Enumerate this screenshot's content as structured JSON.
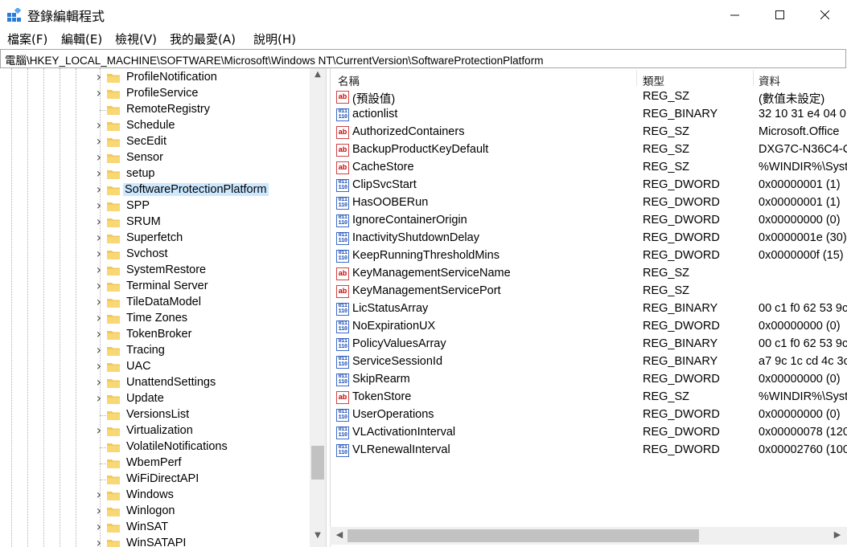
{
  "window": {
    "title": "登錄編輯程式",
    "minimize_glyph": "—",
    "maximize_glyph": "☐",
    "close_glyph": "✕"
  },
  "menu": [
    "檔案(F)",
    "編輯(E)",
    "檢視(V)",
    "我的最愛(A)",
    "說明(H)"
  ],
  "address": "電腦\\HKEY_LOCAL_MACHINE\\SOFTWARE\\Microsoft\\Windows NT\\CurrentVersion\\SoftwareProtectionPlatform",
  "tree": {
    "selected": "SoftwareProtectionPlatform",
    "items": [
      {
        "label": "ProfileNotification",
        "expandable": true
      },
      {
        "label": "ProfileService",
        "expandable": true
      },
      {
        "label": "RemoteRegistry",
        "expandable": false
      },
      {
        "label": "Schedule",
        "expandable": true
      },
      {
        "label": "SecEdit",
        "expandable": true
      },
      {
        "label": "Sensor",
        "expandable": true
      },
      {
        "label": "setup",
        "expandable": true
      },
      {
        "label": "SoftwareProtectionPlatform",
        "expandable": true
      },
      {
        "label": "SPP",
        "expandable": true
      },
      {
        "label": "SRUM",
        "expandable": true
      },
      {
        "label": "Superfetch",
        "expandable": true
      },
      {
        "label": "Svchost",
        "expandable": true
      },
      {
        "label": "SystemRestore",
        "expandable": true
      },
      {
        "label": "Terminal Server",
        "expandable": true
      },
      {
        "label": "TileDataModel",
        "expandable": true
      },
      {
        "label": "Time Zones",
        "expandable": true
      },
      {
        "label": "TokenBroker",
        "expandable": true
      },
      {
        "label": "Tracing",
        "expandable": true
      },
      {
        "label": "UAC",
        "expandable": true
      },
      {
        "label": "UnattendSettings",
        "expandable": true
      },
      {
        "label": "Update",
        "expandable": true
      },
      {
        "label": "VersionsList",
        "expandable": false
      },
      {
        "label": "Virtualization",
        "expandable": true
      },
      {
        "label": "VolatileNotifications",
        "expandable": false
      },
      {
        "label": "WbemPerf",
        "expandable": false
      },
      {
        "label": "WiFiDirectAPI",
        "expandable": false
      },
      {
        "label": "Windows",
        "expandable": true
      },
      {
        "label": "Winlogon",
        "expandable": true
      },
      {
        "label": "WinSAT",
        "expandable": true
      },
      {
        "label": "WinSATAPI",
        "expandable": true
      }
    ]
  },
  "columns": {
    "name": "名稱",
    "type": "類型",
    "data": "資料"
  },
  "values": [
    {
      "kind": "str",
      "name": "(預設值)",
      "type": "REG_SZ",
      "data": "(數值未設定)"
    },
    {
      "kind": "bin",
      "name": "actionlist",
      "type": "REG_BINARY",
      "data": "32 10 31 e4 04 0"
    },
    {
      "kind": "str",
      "name": "AuthorizedContainers",
      "type": "REG_SZ",
      "data": "Microsoft.Office"
    },
    {
      "kind": "str",
      "name": "BackupProductKeyDefault",
      "type": "REG_SZ",
      "data": "DXG7C-N36C4-C"
    },
    {
      "kind": "str",
      "name": "CacheStore",
      "type": "REG_SZ",
      "data": "%WINDIR%\\Syst"
    },
    {
      "kind": "bin",
      "name": "ClipSvcStart",
      "type": "REG_DWORD",
      "data": "0x00000001 (1)"
    },
    {
      "kind": "bin",
      "name": "HasOOBERun",
      "type": "REG_DWORD",
      "data": "0x00000001 (1)"
    },
    {
      "kind": "bin",
      "name": "IgnoreContainerOrigin",
      "type": "REG_DWORD",
      "data": "0x00000000 (0)"
    },
    {
      "kind": "bin",
      "name": "InactivityShutdownDelay",
      "type": "REG_DWORD",
      "data": "0x0000001e (30)"
    },
    {
      "kind": "bin",
      "name": "KeepRunningThresholdMins",
      "type": "REG_DWORD",
      "data": "0x0000000f (15)"
    },
    {
      "kind": "str",
      "name": "KeyManagementServiceName",
      "type": "REG_SZ",
      "data": ""
    },
    {
      "kind": "str",
      "name": "KeyManagementServicePort",
      "type": "REG_SZ",
      "data": ""
    },
    {
      "kind": "bin",
      "name": "LicStatusArray",
      "type": "REG_BINARY",
      "data": "00 c1 f0 62 53 9c"
    },
    {
      "kind": "bin",
      "name": "NoExpirationUX",
      "type": "REG_DWORD",
      "data": "0x00000000 (0)"
    },
    {
      "kind": "bin",
      "name": "PolicyValuesArray",
      "type": "REG_BINARY",
      "data": "00 c1 f0 62 53 9c"
    },
    {
      "kind": "bin",
      "name": "ServiceSessionId",
      "type": "REG_BINARY",
      "data": "a7 9c 1c cd 4c 3c"
    },
    {
      "kind": "bin",
      "name": "SkipRearm",
      "type": "REG_DWORD",
      "data": "0x00000000 (0)"
    },
    {
      "kind": "str",
      "name": "TokenStore",
      "type": "REG_SZ",
      "data": "%WINDIR%\\Syst"
    },
    {
      "kind": "bin",
      "name": "UserOperations",
      "type": "REG_DWORD",
      "data": "0x00000000 (0)"
    },
    {
      "kind": "bin",
      "name": "VLActivationInterval",
      "type": "REG_DWORD",
      "data": "0x00000078 (120"
    },
    {
      "kind": "bin",
      "name": "VLRenewalInterval",
      "type": "REG_DWORD",
      "data": "0x00002760 (100"
    }
  ],
  "icons": {
    "str_text": "ab",
    "bin_text": "011\n110"
  },
  "colors": {
    "selection": "#cce8ff",
    "folder": "#f1c85a",
    "string_icon": "#c00000",
    "binary_icon": "#1f4fb5"
  }
}
